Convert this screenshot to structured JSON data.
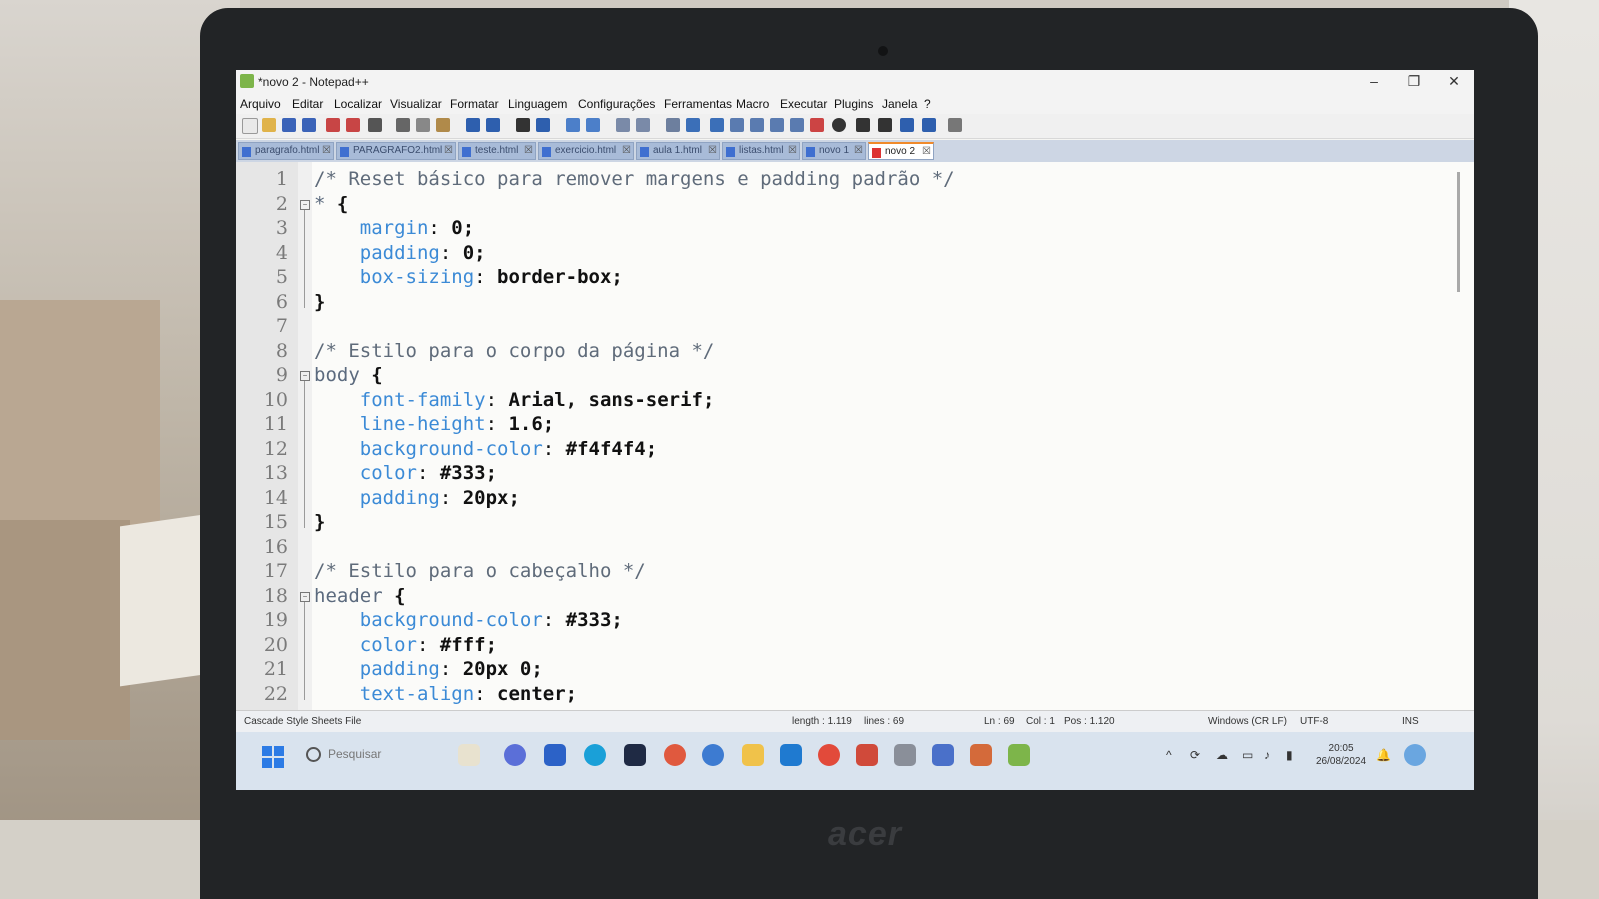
{
  "window": {
    "title": "*novo 2 - Notepad++",
    "controls": [
      "–",
      "❐",
      "✕"
    ]
  },
  "menubar": {
    "items": [
      "Arquivo",
      "Editar",
      "Localizar",
      "Visualizar",
      "Formatar",
      "Linguagem",
      "Configurações",
      "Ferramentas",
      "Macro",
      "Executar",
      "Plugins",
      "Janela",
      "?"
    ]
  },
  "tabs": [
    {
      "label": "paragrafo.html"
    },
    {
      "label": "PARAGRAFO2.html"
    },
    {
      "label": "teste.html"
    },
    {
      "label": "exercicio.html"
    },
    {
      "label": "aula 1.html"
    },
    {
      "label": "listas.html"
    },
    {
      "label": "novo 1"
    },
    {
      "label": "novo 2",
      "active": true
    }
  ],
  "editor": {
    "lines": [
      {
        "no": "1",
        "text": "/* Reset básico para remover margens e padding padrão */"
      },
      {
        "no": "2",
        "text": "* {"
      },
      {
        "no": "3",
        "text": "    margin: 0;"
      },
      {
        "no": "4",
        "text": "    padding: 0;"
      },
      {
        "no": "5",
        "text": "    box-sizing: border-box;"
      },
      {
        "no": "6",
        "text": "}"
      },
      {
        "no": "7",
        "text": ""
      },
      {
        "no": "8",
        "text": "/* Estilo para o corpo da página */"
      },
      {
        "no": "9",
        "text": "body {"
      },
      {
        "no": "10",
        "text": "    font-family: Arial, sans-serif;"
      },
      {
        "no": "11",
        "text": "    line-height: 1.6;"
      },
      {
        "no": "12",
        "text": "    background-color: #f4f4f4;"
      },
      {
        "no": "13",
        "text": "    color: #333;"
      },
      {
        "no": "14",
        "text": "    padding: 20px;"
      },
      {
        "no": "15",
        "text": "}"
      },
      {
        "no": "16",
        "text": ""
      },
      {
        "no": "17",
        "text": "/* Estilo para o cabeçalho */"
      },
      {
        "no": "18",
        "text": "header {"
      },
      {
        "no": "19",
        "text": "    background-color: #333;"
      },
      {
        "no": "20",
        "text": "    color: #fff;"
      },
      {
        "no": "21",
        "text": "    padding: 20px 0;"
      },
      {
        "no": "22",
        "text": "    text-align: center;"
      }
    ]
  },
  "statusbar": {
    "file_type": "Cascade Style Sheets File",
    "length": "length : 1.119",
    "lines": "lines : 69",
    "ln": "Ln : 69",
    "col": "Col : 1",
    "pos": "Pos : 1.120",
    "eol": "Windows (CR LF)",
    "encoding": "UTF-8",
    "mode": "INS"
  },
  "taskbar": {
    "search_placeholder": "Pesquisar",
    "time": "20:05",
    "date": "26/08/2024"
  },
  "hardware": {
    "brand": "acer"
  },
  "colors": {
    "tab_accent": "#f08a2b",
    "css_property": "#3b8ad6",
    "comment": "#5f6b7a"
  }
}
